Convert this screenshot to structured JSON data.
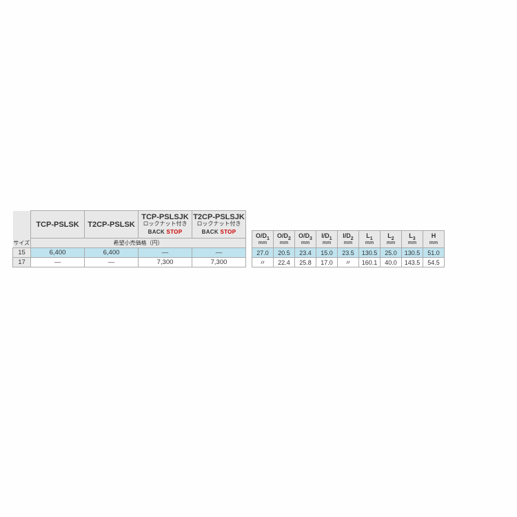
{
  "chart_data": {
    "type": "table",
    "price_table": {
      "size_label": "サイズ",
      "subheader": "希望小売価格（円）",
      "columns": [
        {
          "name": "TCP-PSLSK",
          "sub": "",
          "backstop": false
        },
        {
          "name": "T2CP-PSLSK",
          "sub": "",
          "backstop": false
        },
        {
          "name": "TCP-PSLSJK",
          "sub": "ロックナット付き",
          "backstop": true
        },
        {
          "name": "T2CP-PSLSJK",
          "sub": "ロックナット付き",
          "backstop": true
        }
      ],
      "rows": [
        {
          "size": "15",
          "values": [
            "6,400",
            "6,400",
            "—",
            "—"
          ]
        },
        {
          "size": "17",
          "values": [
            "—",
            "—",
            "7,300",
            "7,300"
          ]
        }
      ]
    },
    "dim_table": {
      "columns": [
        {
          "label": "O/D",
          "sub": "1",
          "unit": "mm"
        },
        {
          "label": "O/D",
          "sub": "2",
          "unit": "mm"
        },
        {
          "label": "O/D",
          "sub": "3",
          "unit": "mm"
        },
        {
          "label": "I/D",
          "sub": "1",
          "unit": "mm"
        },
        {
          "label": "I/D",
          "sub": "2",
          "unit": "mm"
        },
        {
          "label": "L",
          "sub": "1",
          "unit": "mm"
        },
        {
          "label": "L",
          "sub": "2",
          "unit": "mm"
        },
        {
          "label": "L",
          "sub": "3",
          "unit": "mm"
        },
        {
          "label": "H",
          "sub": "",
          "unit": "mm"
        }
      ],
      "rows": [
        [
          "27.0",
          "20.5",
          "23.4",
          "15.0",
          "23.5",
          "130.5",
          "25.0",
          "130.5",
          "51.0"
        ],
        [
          "〃",
          "22.4",
          "25.8",
          "17.0",
          "〃",
          "160.1",
          "40.0",
          "143.5",
          "54.5"
        ]
      ]
    }
  },
  "backstop_text": {
    "back": "BACK",
    "stop": "STOP"
  }
}
